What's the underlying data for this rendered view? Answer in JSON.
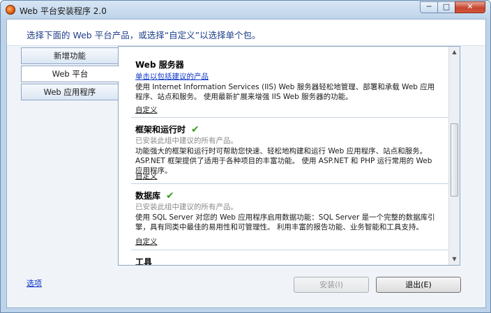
{
  "window": {
    "title": "Web 平台安装程序 2.0",
    "icon": "web-pi-app-icon",
    "controls": {
      "minimize": "─",
      "maximize": "□",
      "close": "✕"
    }
  },
  "header": {
    "instruction": "选择下面的 Web 平台产品，或选择“自定义”以选择单个包。"
  },
  "tabs": [
    {
      "label": "新增功能"
    },
    {
      "label": "Web 平台"
    },
    {
      "label": "Web 应用程序"
    }
  ],
  "sections": {
    "web_server": {
      "title": "Web 服务器",
      "include_link": "单击以包括建议的产品",
      "description": "使用 Internet Information Services (IIS) Web 服务器轻松地管理、部署和承载 Web 应用程序、站点和服务。 使用最新扩展来增强 IIS Web 服务器的功能。",
      "custom": "自定义"
    },
    "frameworks": {
      "title": "框架和运行时",
      "check": "✔",
      "status": "已安装此组中建议的所有产品。",
      "description": "功能强大的框架和运行时可帮助您快速、轻松地构建和运行 Web 应用程序、站点和服务。 ASP.NET 框架提供了适用于各种项目的丰富功能。 使用 ASP.NET 和 PHP 运行常用的 Web 应用程序。",
      "custom": "自定义"
    },
    "database": {
      "title": "数据库",
      "check": "✔",
      "status": "已安装此组中建议的所有产品。",
      "description": "使用 SQL Server 对您的 Web 应用程序启用数据功能：SQL Server 是一个完整的数据库引擎，具有同类中最佳的易用性和可管理性。 利用丰富的报告功能、业务智能和工具支持。",
      "custom": "自定义"
    },
    "tools": {
      "title": "工具"
    }
  },
  "footer": {
    "options_link": "选项",
    "install_button": "安装(I)",
    "exit_button": "退出(E)"
  },
  "colors": {
    "frame": "#bcd3ea",
    "link": "#0a33c7",
    "check": "#3a9c1e",
    "header_text": "#1e3e8a"
  }
}
